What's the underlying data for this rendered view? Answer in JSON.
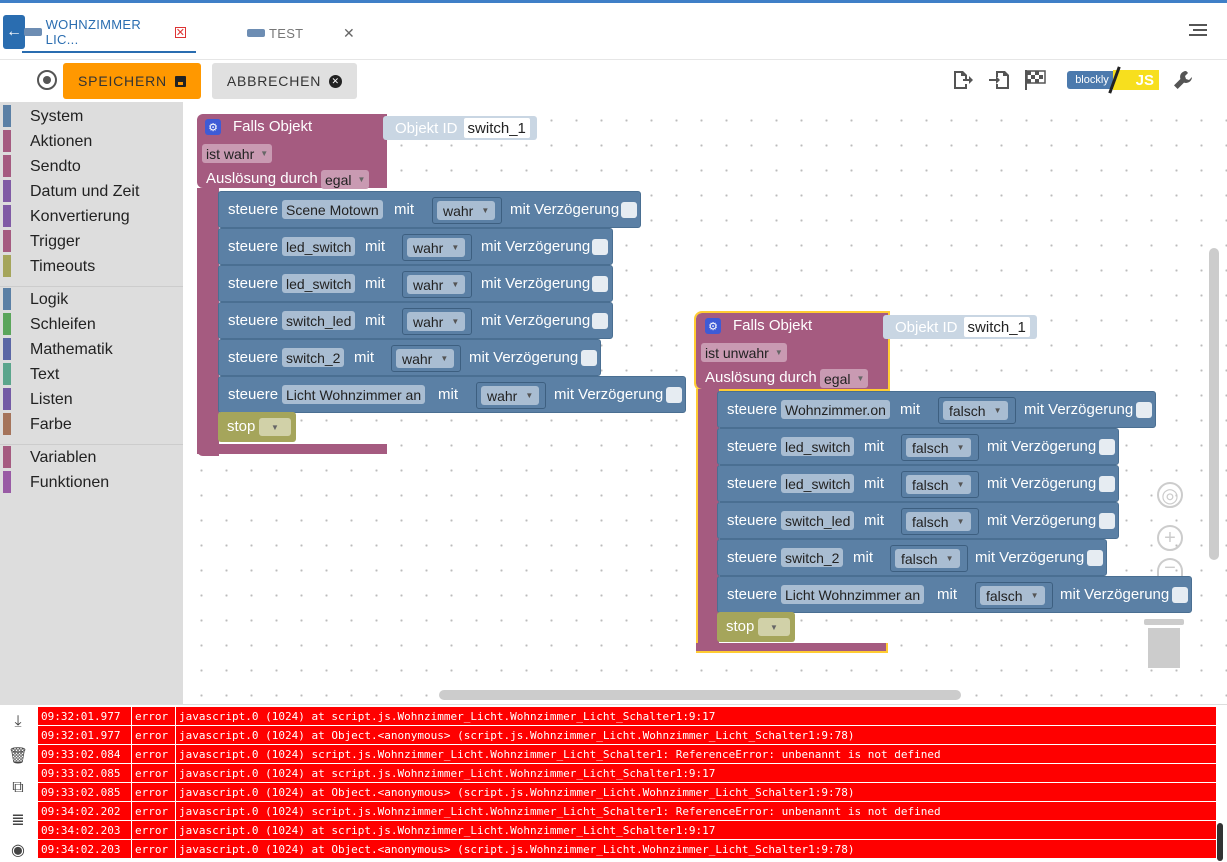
{
  "tabs": [
    {
      "label": "WOHNZIMMER LIC...",
      "active": true
    },
    {
      "label": "TEST",
      "active": false
    }
  ],
  "toolbar": {
    "save_label": "SPEICHERN",
    "cancel_label": "ABBRECHEN",
    "blockly_label": "blockly",
    "js_label": "JS"
  },
  "categories": [
    {
      "label": "System",
      "color": "#5b80a5"
    },
    {
      "label": "Aktionen",
      "color": "#a55b80"
    },
    {
      "label": "Sendto",
      "color": "#a55b80"
    },
    {
      "label": "Datum und Zeit",
      "color": "#805ba5"
    },
    {
      "label": "Konvertierung",
      "color": "#805ba5"
    },
    {
      "label": "Trigger",
      "color": "#a55b80"
    },
    {
      "label": "Timeouts",
      "color": "#a5a55b"
    },
    {
      "label": "Logik",
      "color": "#5b80a5"
    },
    {
      "label": "Schleifen",
      "color": "#5ba55b"
    },
    {
      "label": "Mathematik",
      "color": "#5b67a5"
    },
    {
      "label": "Text",
      "color": "#5ba58c"
    },
    {
      "label": "Listen",
      "color": "#745ba5"
    },
    {
      "label": "Farbe",
      "color": "#a5745b"
    },
    {
      "label": "Variablen",
      "color": "#a55b80"
    },
    {
      "label": "Funktionen",
      "color": "#995ba5"
    }
  ],
  "block1": {
    "title": "Falls Objekt",
    "objid_label": "Objekt ID",
    "objid_value": "switch_1",
    "condition": "ist wahr",
    "trigger_label": "Auslösung durch",
    "trigger_value": "egal",
    "rows": [
      {
        "verb": "steuere",
        "target": "Scene Motown",
        "with": "mit",
        "value": "wahr",
        "delay": "mit Verzögerung"
      },
      {
        "verb": "steuere",
        "target": "led_switch",
        "with": "mit",
        "value": "wahr",
        "delay": "mit Verzögerung"
      },
      {
        "verb": "steuere",
        "target": "led_switch",
        "with": "mit",
        "value": "wahr",
        "delay": "mit Verzögerung"
      },
      {
        "verb": "steuere",
        "target": "switch_led",
        "with": "mit",
        "value": "wahr",
        "delay": "mit Verzögerung"
      },
      {
        "verb": "steuere",
        "target": "switch_2",
        "with": "mit",
        "value": "wahr",
        "delay": "mit Verzögerung"
      },
      {
        "verb": "steuere",
        "target": "Licht Wohnzimmer an",
        "with": "mit",
        "value": "wahr",
        "delay": "mit Verzögerung"
      }
    ],
    "stop_label": "stop"
  },
  "block2": {
    "title": "Falls Objekt",
    "objid_label": "Objekt ID",
    "objid_value": "switch_1",
    "condition": "ist unwahr",
    "trigger_label": "Auslösung durch",
    "trigger_value": "egal",
    "rows": [
      {
        "verb": "steuere",
        "target": "Wohnzimmer.on",
        "with": "mit",
        "value": "falsch",
        "delay": "mit Verzögerung"
      },
      {
        "verb": "steuere",
        "target": "led_switch",
        "with": "mit",
        "value": "falsch",
        "delay": "mit Verzögerung"
      },
      {
        "verb": "steuere",
        "target": "led_switch",
        "with": "mit",
        "value": "falsch",
        "delay": "mit Verzögerung"
      },
      {
        "verb": "steuere",
        "target": "switch_led",
        "with": "mit",
        "value": "falsch",
        "delay": "mit Verzögerung"
      },
      {
        "verb": "steuere",
        "target": "switch_2",
        "with": "mit",
        "value": "falsch",
        "delay": "mit Verzögerung"
      },
      {
        "verb": "steuere",
        "target": "Licht Wohnzimmer an",
        "with": "mit",
        "value": "falsch",
        "delay": "mit Verzögerung"
      }
    ],
    "stop_label": "stop"
  },
  "log": [
    {
      "time": "09:32:01.977",
      "level": "error",
      "msg": "javascript.0 (1024) at script.js.Wohnzimmer_Licht.Wohnzimmer_Licht_Schalter1:9:17"
    },
    {
      "time": "09:32:01.977",
      "level": "error",
      "msg": "javascript.0 (1024) at Object.<anonymous> (script.js.Wohnzimmer_Licht.Wohnzimmer_Licht_Schalter1:9:78)"
    },
    {
      "time": "09:33:02.084",
      "level": "error",
      "msg": "javascript.0 (1024) script.js.Wohnzimmer_Licht.Wohnzimmer_Licht_Schalter1: ReferenceError: unbenannt is not defined"
    },
    {
      "time": "09:33:02.085",
      "level": "error",
      "msg": "javascript.0 (1024) at script.js.Wohnzimmer_Licht.Wohnzimmer_Licht_Schalter1:9:17"
    },
    {
      "time": "09:33:02.085",
      "level": "error",
      "msg": "javascript.0 (1024) at Object.<anonymous> (script.js.Wohnzimmer_Licht.Wohnzimmer_Licht_Schalter1:9:78)"
    },
    {
      "time": "09:34:02.202",
      "level": "error",
      "msg": "javascript.0 (1024) script.js.Wohnzimmer_Licht.Wohnzimmer_Licht_Schalter1: ReferenceError: unbenannt is not defined"
    },
    {
      "time": "09:34:02.203",
      "level": "error",
      "msg": "javascript.0 (1024) at script.js.Wohnzimmer_Licht.Wohnzimmer_Licht_Schalter1:9:17"
    },
    {
      "time": "09:34:02.203",
      "level": "error",
      "msg": "javascript.0 (1024) at Object.<anonymous> (script.js.Wohnzimmer_Licht.Wohnzimmer_Licht_Schalter1:9:78)"
    }
  ],
  "colors": {
    "accent": "#2a6db0",
    "save": "#ff9800",
    "error": "#ff0000",
    "event_block": "#a55b80",
    "action_block": "#5b80a5",
    "stop_block": "#a5a55b"
  }
}
